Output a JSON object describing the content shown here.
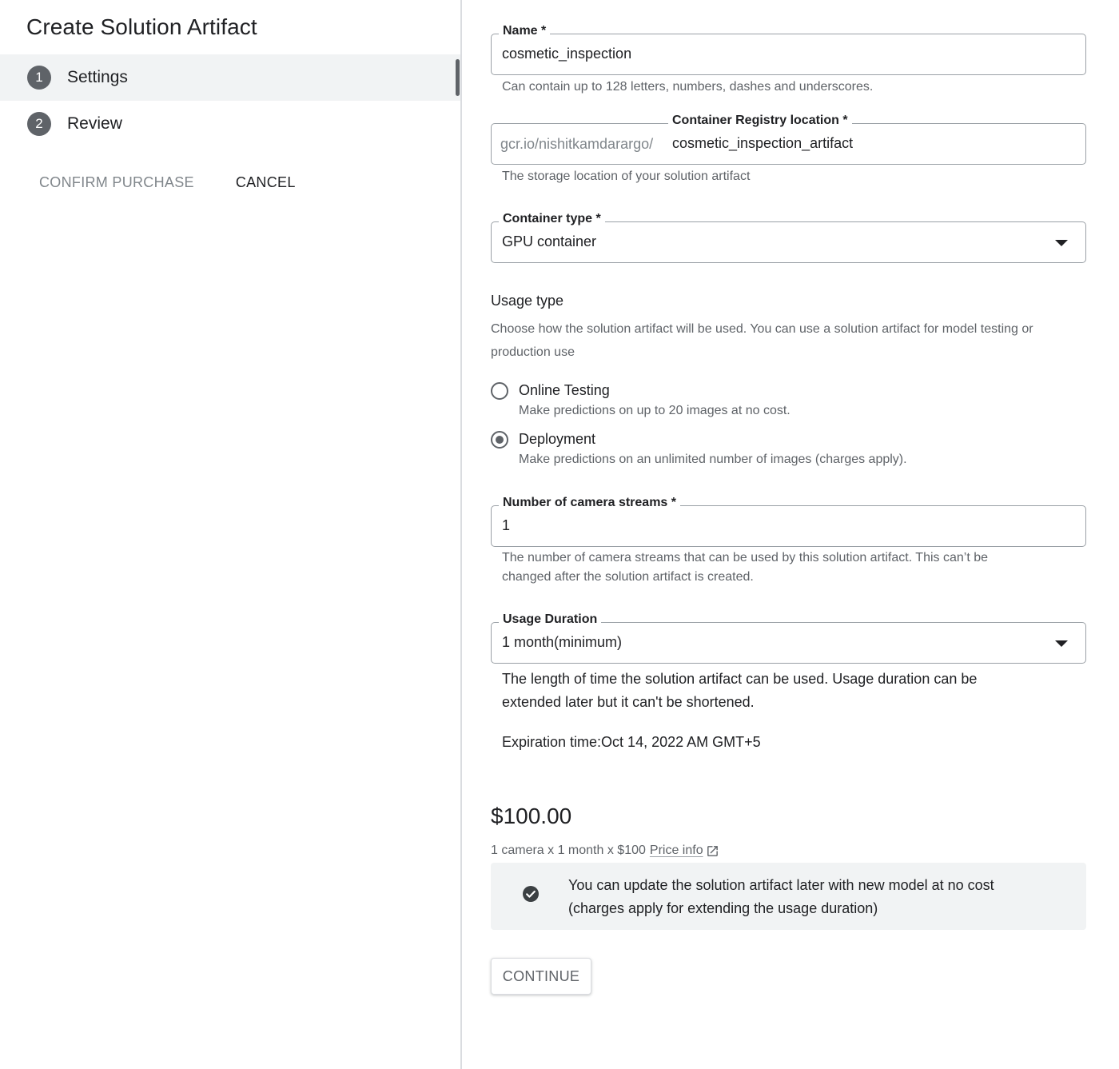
{
  "left": {
    "title": "Create Solution Artifact",
    "steps": [
      {
        "number": "1",
        "label": "Settings",
        "active": true
      },
      {
        "number": "2",
        "label": "Review",
        "active": false
      }
    ],
    "confirm_label": "CONFIRM PURCHASE",
    "cancel_label": "CANCEL"
  },
  "form": {
    "name": {
      "label": "Name *",
      "value": "cosmetic_inspection",
      "hint": "Can contain up to 128 letters, numbers, dashes and underscores."
    },
    "registry": {
      "label": "Container Registry location *",
      "prefix": "gcr.io/nishitkamdarargo/",
      "value": "cosmetic_inspection_artifact",
      "hint": "The storage location of your solution artifact"
    },
    "container_type": {
      "label": "Container type *",
      "value": "GPU container"
    },
    "usage_type": {
      "title": "Usage type",
      "description": "Choose how the solution artifact will be used. You can use a solution artifact for model testing or production use",
      "options": [
        {
          "label": "Online Testing",
          "description": "Make predictions on up to 20 images at no cost.",
          "selected": false
        },
        {
          "label": "Deployment",
          "description": "Make predictions on an unlimited number of images (charges apply).",
          "selected": true
        }
      ]
    },
    "camera_streams": {
      "label": "Number of camera streams *",
      "value": "1",
      "hint_line1": "The number of camera streams that can be used by this solution artifact. This can’t be",
      "hint_line2": "changed after the solution artifact is created."
    },
    "usage_duration": {
      "label": "Usage Duration",
      "value": "1 month(minimum)",
      "hint_line1": "The length of time the solution artifact can be used. Usage duration can be",
      "hint_line2": "extended later but it can't be shortened.",
      "expiration": "Expiration time:Oct 14, 2022 AM GMT+5"
    }
  },
  "pricing": {
    "total": "$100.00",
    "breakdown": "1 camera x 1 month x $100",
    "link_label": "Price info",
    "notice_line1": "You can update the solution artifact later with new model at no cost",
    "notice_line2": "(charges apply for extending the usage duration)"
  },
  "continue_label": "CONTINUE"
}
